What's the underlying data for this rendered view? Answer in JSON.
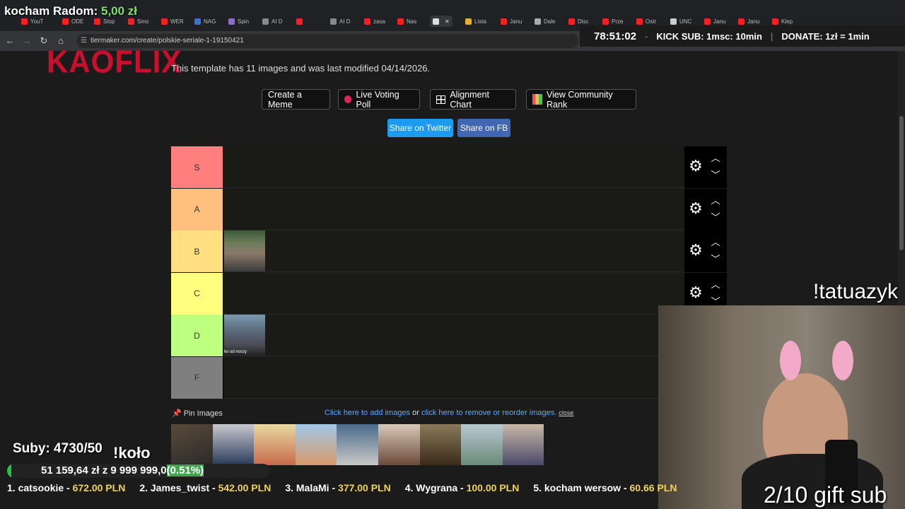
{
  "stream": {
    "donation_name": "kocham Radom:",
    "donation_amount": "5,00 zł",
    "timer": "78:51:02",
    "kick_sub": "KICK SUB: 1msc: 10min",
    "donate": "DONATE: 1zł = 1min",
    "subs": "Suby: 4730/50",
    "kolo": "!koło",
    "goal_text": "51 159,64 zł z  9 999 999,0",
    "goal_pct": "(0.51%)",
    "goal_fraction": 0.0051,
    "tatua": "!tatuazyk",
    "gift_sub": "2/10 gift sub",
    "leaders": [
      {
        "rank": "1. catsookie -",
        "value": "672.00 PLN"
      },
      {
        "rank": "2. James_twist -",
        "value": "542.00 PLN"
      },
      {
        "rank": "3. MalaMi -",
        "value": "377.00 PLN"
      },
      {
        "rank": "4. Wygrana -",
        "value": "100.00 PLN"
      },
      {
        "rank": "5. kocham wersow -",
        "value": "60.66 PLN"
      }
    ]
  },
  "browser": {
    "url": "tiermaker.com/create/polskie-seriale-1-19150421",
    "tabs": [
      "YouT",
      "ODE",
      "Stop",
      "Smo",
      "WER",
      "NAG",
      "Spin",
      "AI D",
      "",
      "AI D",
      "zasa",
      "Nas",
      "",
      "Lista",
      "Janu",
      "Dale",
      "Disc",
      "Prze",
      "Ostr",
      "UNC",
      "Janu",
      "Janu",
      "Klep"
    ]
  },
  "page": {
    "logo": "KAOFLIX",
    "info": "This template has 11 images and was last modified 04/14/2026.",
    "buttons": {
      "meme": "Create a Meme",
      "poll": "Live Voting Poll",
      "alignment": "Alignment Chart",
      "community": "View Community Rank"
    },
    "share_twitter": "Share on Twitter",
    "share_fb": "Share on FB",
    "pin_images": "Pin Images",
    "add_link": "Click here to add images",
    "or": " or ",
    "reorder_link": "click here to remove or reorder images.",
    "close": "close",
    "thumb_caption": "ko od noszy"
  },
  "tiers": [
    {
      "label": "S",
      "color": "#ff7f7f"
    },
    {
      "label": "A",
      "color": "#ffbf7f"
    },
    {
      "label": "B",
      "color": "#ffdf7f"
    },
    {
      "label": "C",
      "color": "#ffff7f"
    },
    {
      "label": "D",
      "color": "#bfff7f"
    },
    {
      "label": "F",
      "color": "#7f7f7f"
    }
  ]
}
